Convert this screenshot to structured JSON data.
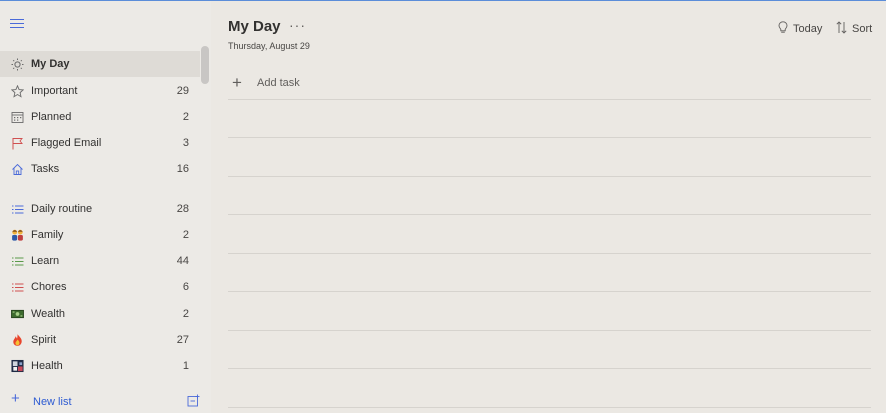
{
  "sidebar": {
    "smart_lists": [
      {
        "label": "My Day",
        "count": "",
        "icon": "sun-icon"
      },
      {
        "label": "Important",
        "count": "29",
        "icon": "star-icon"
      },
      {
        "label": "Planned",
        "count": "2",
        "icon": "calendar-icon"
      },
      {
        "label": "Flagged Email",
        "count": "3",
        "icon": "flag-icon"
      },
      {
        "label": "Tasks",
        "count": "16",
        "icon": "home-icon"
      }
    ],
    "lists": [
      {
        "label": "Daily routine",
        "count": "28",
        "icon": "list-icon"
      },
      {
        "label": "Family",
        "count": "2",
        "icon": "family-emoji-icon"
      },
      {
        "label": "Learn",
        "count": "44",
        "icon": "list-icon"
      },
      {
        "label": "Chores",
        "count": "6",
        "icon": "list-icon"
      },
      {
        "label": "Wealth",
        "count": "2",
        "icon": "money-emoji-icon"
      },
      {
        "label": "Spirit",
        "count": "27",
        "icon": "fire-emoji-icon"
      },
      {
        "label": "Health",
        "count": "1",
        "icon": "health-emoji-icon"
      }
    ],
    "new_list_label": "New list"
  },
  "main": {
    "title": "My Day",
    "date": "Thursday, August 29",
    "more_label": "···",
    "today_label": "Today",
    "sort_label": "Sort",
    "add_task_label": "Add task"
  },
  "colors": {
    "accent": "#4a6ad9",
    "important": "#6b6b6b",
    "flag": "#d05050",
    "learn": "#5a9a4a",
    "chores": "#d05050"
  }
}
